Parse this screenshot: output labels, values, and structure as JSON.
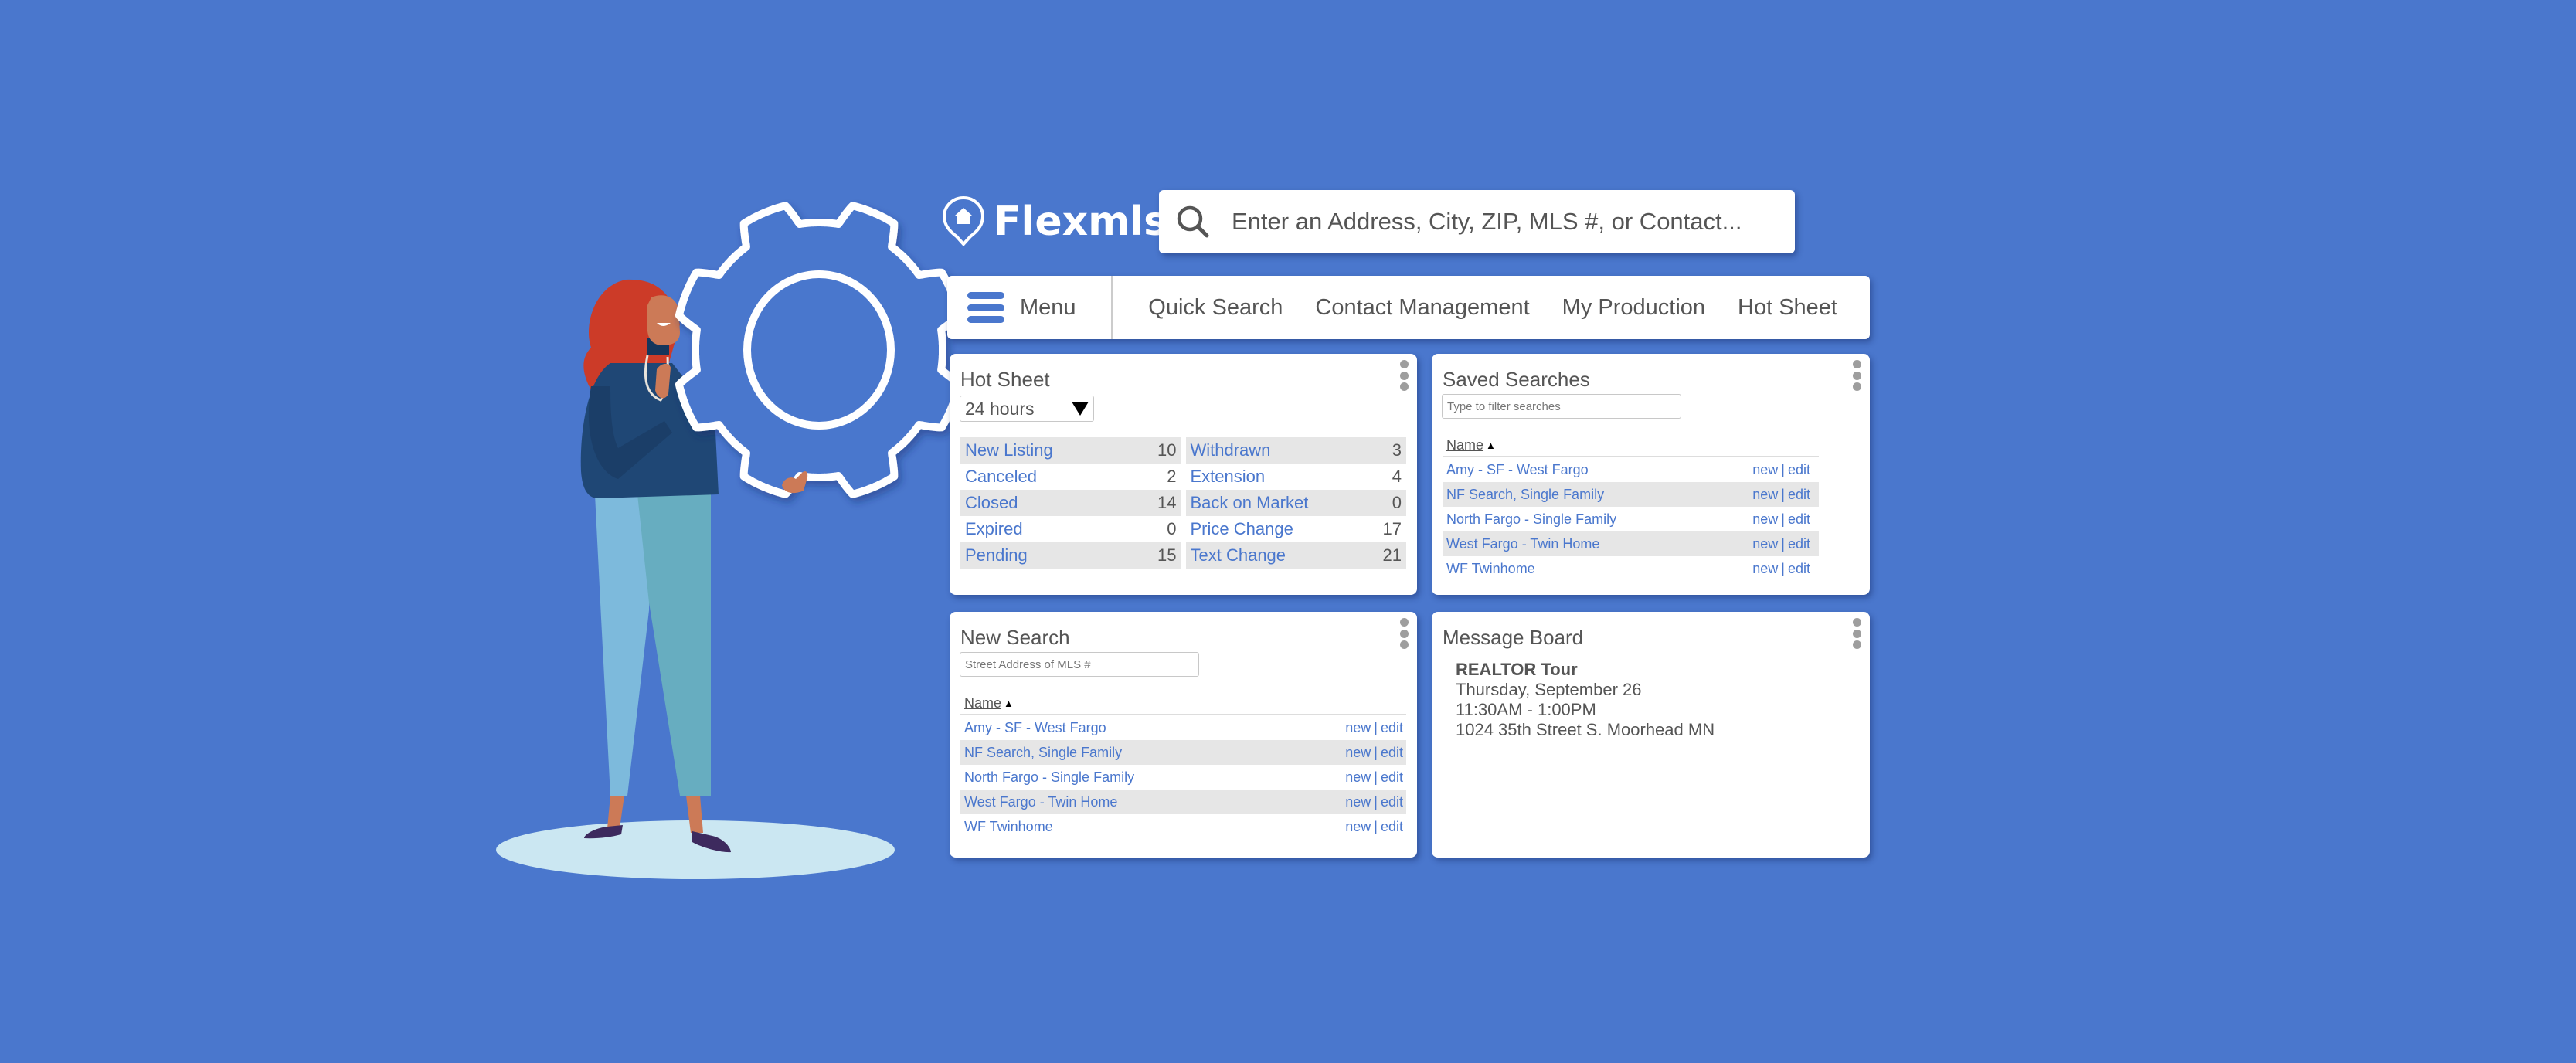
{
  "brand": {
    "name": "Flexmls",
    "accent_color": "#4a77cd",
    "background_color": "#4a77cd"
  },
  "search": {
    "placeholder": "Enter an Address, City, ZIP, MLS #, or Contact...",
    "value": "",
    "icon": "search-icon"
  },
  "nav": {
    "menu_label": "Menu",
    "menu_icon": "hamburger-icon",
    "items": [
      {
        "label": "Quick Search"
      },
      {
        "label": "Contact Management"
      },
      {
        "label": "My Production"
      },
      {
        "label": "Hot Sheet"
      }
    ]
  },
  "hot_sheet": {
    "title": "Hot Sheet",
    "period": "24 hours",
    "left": [
      {
        "label": "New Listing",
        "count": "10"
      },
      {
        "label": "Canceled",
        "count": "2"
      },
      {
        "label": "Closed",
        "count": "14"
      },
      {
        "label": "Expired",
        "count": "0"
      },
      {
        "label": "Pending",
        "count": "15"
      }
    ],
    "right": [
      {
        "label": "Withdrawn",
        "count": "3"
      },
      {
        "label": "Extension",
        "count": "4"
      },
      {
        "label": "Back on Market",
        "count": "0"
      },
      {
        "label": "Price Change",
        "count": "17"
      },
      {
        "label": "Text Change",
        "count": "21"
      }
    ]
  },
  "saved_searches": {
    "title": "Saved Searches",
    "filter_placeholder": "Type to filter searches",
    "filter_value": "",
    "column_header": "Name",
    "sort_indicator": "▲",
    "rows": [
      {
        "name": "Amy - SF - West Fargo",
        "new": "new",
        "sep": "|",
        "edit": "edit"
      },
      {
        "name": "NF Search, Single Family",
        "new": "new",
        "sep": "|",
        "edit": "edit"
      },
      {
        "name": "North Fargo - Single Family",
        "new": "new",
        "sep": "|",
        "edit": "edit"
      },
      {
        "name": "West Fargo - Twin Home",
        "new": "new",
        "sep": "|",
        "edit": "edit"
      },
      {
        "name": "WF Twinhome",
        "new": "new",
        "sep": "|",
        "edit": "edit"
      }
    ]
  },
  "new_search": {
    "title": "New Search",
    "input_placeholder": "Street Address of MLS #",
    "input_value": "",
    "column_header": "Name",
    "sort_indicator": "▲",
    "rows": [
      {
        "name": "Amy - SF - West Fargo",
        "new": "new",
        "sep": "|",
        "edit": "edit"
      },
      {
        "name": "NF Search, Single Family",
        "new": "new",
        "sep": "|",
        "edit": "edit"
      },
      {
        "name": "North Fargo - Single Family",
        "new": "new",
        "sep": "|",
        "edit": "edit"
      },
      {
        "name": "West Fargo - Twin Home",
        "new": "new",
        "sep": "|",
        "edit": "edit"
      },
      {
        "name": "WF Twinhome",
        "new": "new",
        "sep": "|",
        "edit": "edit"
      }
    ]
  },
  "message_board": {
    "title": "Message Board",
    "message": {
      "title": "REALTOR Tour",
      "date": "Thursday, September 26",
      "time": "11:30AM - 1:00PM",
      "address": "1024 35th Street S. Moorhead MN"
    }
  },
  "illustration": {
    "subject": "woman holding a large gear",
    "colors": {
      "hair": "#cc3b28",
      "skin": "#cc7a57",
      "sweater": "#1f4775",
      "pants_light": "#7dbadc",
      "pants_dark": "#67adc0",
      "shoes": "#3d2a5e",
      "floor": "#cbe7f2",
      "gear_outline": "#ffffff"
    }
  }
}
